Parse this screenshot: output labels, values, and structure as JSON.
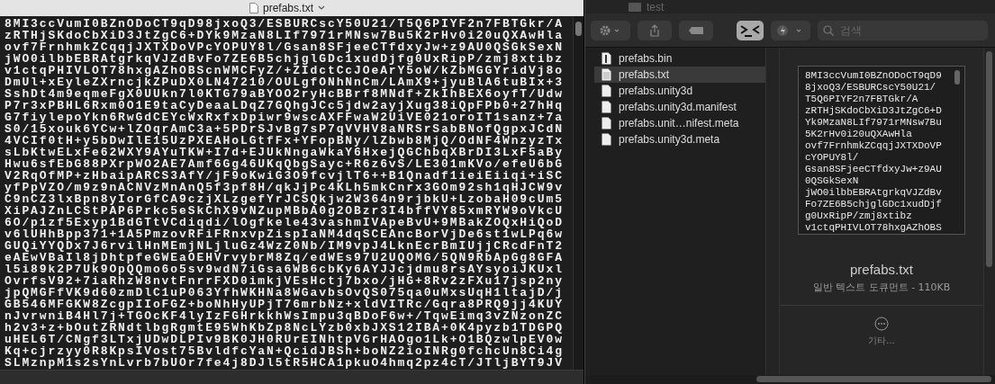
{
  "editor": {
    "title": "prefabs.txt",
    "lines": [
      "8MI3ccVumI0BZnODoCT9qD98jxoQ3/ESBURCscY50U21/T5Q6PIYF2n7FBTGkr/A",
      "zRTHjSKdoCbXiD3JtZgC6+DYk9MzaN8LIf7971rMNsw7Bu5K2rHv0i20uQXAwHla",
      "ovf7FrnhmkZCqqjJXTXDoVPcYOPUY8l/Gsan8SFjeeCTfdxyJw+z9AU0QSGkSexN",
      "jWO0ilbbEBRAtgrkqVJZdBvFo7ZE6B5chjglGDc1xudDjfg0UxRipP/zmj8xtibz",
      "v1ctqPHIVLOT78hxgAZhOBScnWMCFyZ/+ZIdctCcJOeArY5oW/kZbMGGYridVj8o",
      "DmUl+xEyleZXrncjkZPuDX0LN47210/OULgfONhNnCm/LAmX9+jyuBlA6tuBIx+3",
      "SshDt4m9eqmeFgX0UUkn7l0KTG79aBYOO2ryHcBBrf8MNdf+ZkIhBEX6oyfT/Udw",
      "P7r3xPBHL6Rxm0O1E9taCyDeaaLDqZ7GQhgJCc5jdw2ayjXug38iQpFPb0+27hHq",
      "G7fiylepoYkn6RwGdCEYcWxRxfxDpiwr9wscAXFFwaW2UiVE021oroIT1sanz+7a",
      "S0/15xouk6YCw+lZOqrAmC3a+5PDrSJvBg7sP7qVVHV8aNRSrSabBNofQgpxJCdN",
      "4VCIf0tH+y5bDwIlE15UzPXEAHoLGtfFx+YFopBNy/lZbwb8MjQ/OdNF4WnzyzTx",
      "sLbKtwELxFe62WXY9AYuTKW+I7d+EJUkNngaWkaY6HxejQGChbqXBrDI3LxF5aBy",
      "Hwu6sfEbG88PXrpWO2AE7Amf6Gg46UKqQbgSayc+R6z6vS/LE301mKVo/efeU6bG",
      "V2RqOfMP+zHbaipARCS3AfY/jF9oKwiG3O9fcvjlT6++B1Qnadf1ieiEiiqi+iSC",
      "yfPpVZO/m9z9nACNVzMnAnQ5f3pf8H/qkJjPc4KLh5mkCnrx3GOm92sh1qHJCW9v",
      "C9nCZ3lxBpn8yIorGfCA9czjXLzgefYrJCSQkjw2W364n9rjbkU+LzobaH09cUm5",
      "XiPAJZnLCStPAP6Prkc5eSkChX9vNZupMBbA0g2OBzr3I4bffVY85xmRYW9oVkcU",
      "6O/p1zf5Exyp1BdGTtVCdiqdi/lOgfkele43vashmIVApeBvU+9MBakZOQxHiQoD",
      "v6lUHhBpp371+1A5PmzovRFiFRnxvpZispIaNM4dqSCEAncBorVjDe6st1wLPq6w",
      "GUQiYYQDx7J6rvilHnMEmjNLjluGz4WzZ0Nb/IM9vpJ4LknEcrBmIUjjCRcdFnT2",
      "eAEwVBaIl8jDhtpfeGWEaOEHVrvybrM8Zq/edWEs97U2UQOMG/5QN9RbApGg8GFA",
      "l5i89k2P7Uk9OpQQmo6o5sv9wdN7iGsa6WB6cbKy6AYJJcjdmu8rsAYsyoiJKUxl",
      "OvrfsV92+7iaRhzW8nvtFnrrFXD0imkjVEsHctj7bxo/jHG+8Rv2zFXu17jsp2ny",
      "jpQMGFfVK9d60zmDlC1uP063YfhWKHNa8WGavbsOvQS075qa0uMxsUqH1ltajD/j",
      "GB546MFGKW8ZcgpIIoFGZ+boNhHyUPjT76mrbNz+xldVITRc/Gqra8PRQ9jj4KUY",
      "nJvrwniB4Hl7j+TGOcKF4lyIzFGHrkkhWsImpu3qBDoF6w+/TqwEimq3vZNzonZC",
      "h2v3+z+bOutZRNdtlbgRgmtE95WhKbZp8NcLYzb0xbJXS12IBA+0K4pyzb1TDGPQ",
      "uHEL6T/CNgf3LTxjUDwDLPIv9BK0JH0RUrEINhtpVGrHAOgo1Lk+O1BQzwlpEV0w",
      "Kq+cjrzyy0R8KpsIVost75BvldfcYaN+QcidJBSh+boNZ2ioINRg0fchcUn8Ci4g",
      "SLMznpM1s2sYnLvrb7bUOr7fe4j8DJl5tR5HCA1pkuO4hmq2pz4cT/JTljBYT9JV"
    ]
  },
  "finder": {
    "title": "test",
    "search": {
      "placeholder": "검색"
    },
    "files": [
      {
        "name": "prefabs.bin",
        "kind": "binary",
        "selected": false
      },
      {
        "name": "prefabs.txt",
        "kind": "text",
        "selected": true
      },
      {
        "name": "prefabs.unity3d",
        "kind": "plain",
        "selected": false
      },
      {
        "name": "prefabs.unity3d.manifest",
        "kind": "plain",
        "selected": false
      },
      {
        "name": "prefabs.unit…nifest.meta",
        "kind": "plain",
        "selected": false
      },
      {
        "name": "prefabs.unity3d.meta",
        "kind": "plain",
        "selected": false
      }
    ],
    "preview": {
      "lines": [
        "8MI3ccVumI0BZnODoCT9qD9",
        "8jxoQ3/ESBURCscY50U21/",
        "T5Q6PIYF2n7FBTGkr/A",
        "zRTHjSKdoCbXiD3JtZgC6+D",
        "Yk9MzaN8LIf7971rMNsw7Bu",
        "5K2rHv0i20uQXAwHla",
        "ovf7FrnhmkZCqqjJXTXDoVP",
        "cYOPUY8l/",
        "Gsan8SFjeeCTfdxyJw+z9AU",
        "0QSGkSexN",
        "jWO0ilbbEBRAtgrkqVJZdBv",
        "Fo7ZE6B5chjglGDc1xudDjf",
        "g0UxRipP/zmj8xtibz",
        "v1ctqPHIVLOT78hxgAZhOBS"
      ],
      "name": "prefabs.txt",
      "info": "일반 텍스트 도큐먼트 - 110KB",
      "more": "기타..."
    }
  }
}
